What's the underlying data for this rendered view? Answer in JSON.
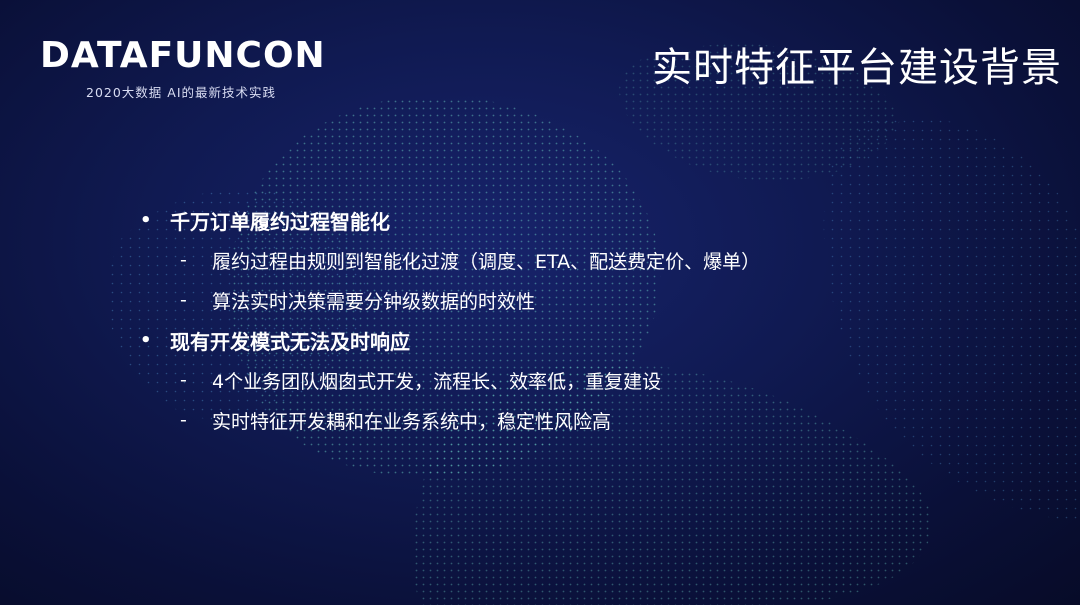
{
  "header": {
    "logo": "DATAFUNCON",
    "logo_subtitle": "2020大数据  AI的最新技术实践",
    "title": "实时特征平台建设背景"
  },
  "content": {
    "bullets": [
      {
        "text": "千万订单履约过程智能化",
        "subs": [
          "履约过程由规则到智能化过渡（调度、ETA、配送费定价、爆单）",
          "算法实时决策需要分钟级数据的时效性"
        ]
      },
      {
        "text": "现有开发模式无法及时响应",
        "subs": [
          "4个业务团队烟囱式开发，流程长、效率低，重复建设",
          "实时特征开发耦和在业务系统中，稳定性风险高"
        ]
      }
    ],
    "bullet_marker": "•",
    "sub_marker": "-"
  },
  "colors": {
    "background": "#101a52",
    "text": "#ffffff",
    "particles": "#6fd6c8"
  }
}
